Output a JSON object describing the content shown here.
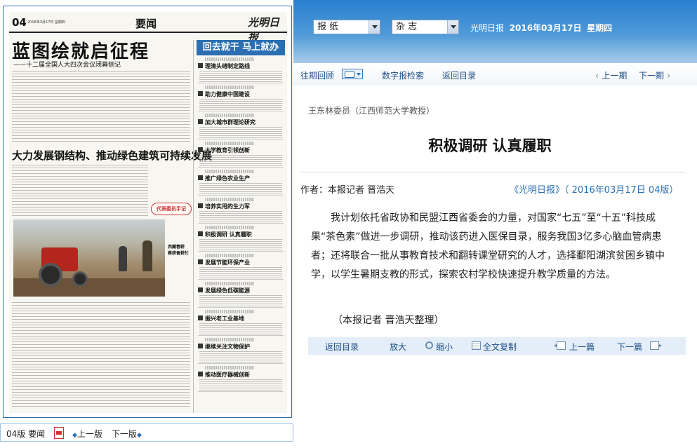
{
  "newspaper": {
    "page_number": "04",
    "page_date": "2016年3月17日 星期四",
    "section": "要闻",
    "logo": "光明日报",
    "headline_main": "蓝图绘就启征程",
    "subhead_main": "——十二届全国人大四次会议闭幕侧记",
    "headline_second": "大力发展钢结构、推动绿色建筑可持续发展",
    "right_banner": "回去就干 马上就办",
    "right_items": [
      "理清头绪制定路线",
      "助力健康中国建设",
      "加大城市群理论研究",
      "大学教育引领创新",
      "推广绿色农业生产",
      "培养实用的生力军",
      "积极调研 认真履职",
      "发展节能环保产业",
      "发展绿色低碳能源",
      "振兴老工业基地",
      "继续关注文物保护",
      "推动医疗器械创新"
    ],
    "badge": "代表委员手记",
    "photo_caption": "西藏春耕 春耕备耕忙"
  },
  "page_bar": {
    "label": "04版 要闻",
    "prev": "上一版",
    "next": "下一版"
  },
  "header": {
    "select1": "报 纸",
    "select2": "杂 志",
    "paper_name": "光明日报",
    "date": "2016年03月17日",
    "weekday": "星期四"
  },
  "toolbar": {
    "history": "往期回顾",
    "digital": "数字报检索",
    "back": "返回目录",
    "prev_issue": "上一期",
    "next_issue": "下一期"
  },
  "article": {
    "author_intro": "王东林委员（江西师范大学教授）",
    "title": "积极调研 认真履职",
    "byline": "作者：本报记者  晋浩天",
    "source": "《光明日报》（ 2016年03月17日  04版）",
    "body": "我计划依托省政协和民盟江西省委会的力量，对国家“七五”至“十五”科技成果“茶色素”做进一步调研，推动该药进入医保目录，服务我国3亿多心脑血管病患者；还将联合一批从事教育技术和翻转课堂研究的人才，选择鄱阳湖滨贫困乡镇中学，以学生暑期支教的形式，探索农村学校快速提升教学质量的方法。",
    "closing": "（本报记者  晋浩天整理）"
  },
  "bottom_bar": {
    "back": "返回目录",
    "enlarge": "放大",
    "shrink": "缩小",
    "copy": "全文复制",
    "prev_article": "上一篇",
    "next_article": "下一篇"
  }
}
